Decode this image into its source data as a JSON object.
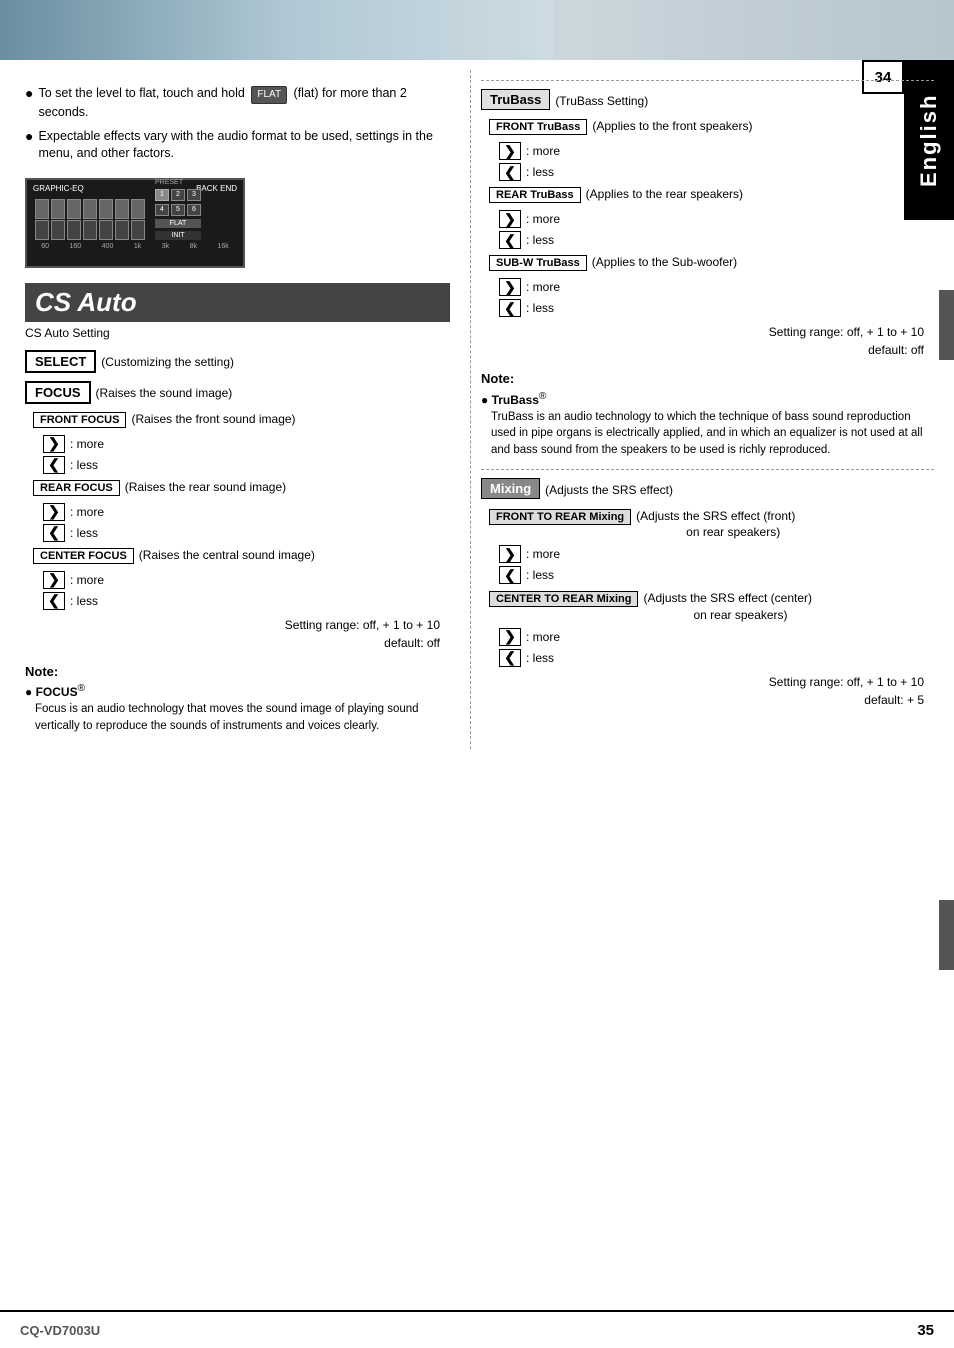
{
  "page": {
    "number_left": "34",
    "number_right": "35",
    "model": "CQ-VD7003U",
    "language": "English"
  },
  "left": {
    "bullets": [
      {
        "id": "b1",
        "text_before": "To set the level to flat, touch and hold",
        "btn_label": "FLAT",
        "text_after": "(flat) for more than 2 seconds."
      },
      {
        "id": "b2",
        "text": "Expectable effects vary with the audio format to be used, settings in the menu, and other factors."
      }
    ],
    "section_title": "CS Auto",
    "section_subtitle": "CS Auto Setting",
    "select_label": "SELECT",
    "select_desc": "(Customizing the setting)",
    "focus_label": "FOCUS",
    "focus_desc": "(Raises the sound image)",
    "front_focus_label": "FRONT FOCUS",
    "front_focus_desc": "(Raises the front sound image)",
    "rear_focus_label": "REAR FOCUS",
    "rear_focus_desc": "(Raises the rear sound image)",
    "center_focus_label": "CENTER FOCUS",
    "center_focus_desc": "(Raises the central sound image)",
    "more_label": ": more",
    "less_label": ": less",
    "setting_range_line1": "Setting range: off, + 1 to + 10",
    "setting_range_line2": "default: off",
    "note_title": "Note:",
    "note_bullet": "● FOCUS",
    "note_superscript": "®",
    "note_body": "Focus is an audio technology that moves the sound image of playing sound vertically to reproduce the sounds of instruments and voices clearly."
  },
  "right": {
    "trubass_section": {
      "header": "TruBass",
      "header_paren": "(TruBass Setting)",
      "front_label": "FRONT TruBass",
      "front_desc": "(Applies to the front speakers)",
      "rear_label": "REAR TruBass",
      "rear_desc": "(Applies to the rear speakers)",
      "subw_label": "SUB-W TruBass",
      "subw_desc": "(Applies to the Sub-woofer)",
      "more_label": ": more",
      "less_label": ": less",
      "setting_range_line1": "Setting range: off, + 1 to + 10",
      "setting_range_line2": "default: off",
      "note_title": "Note:",
      "note_bullet": "● TruBass",
      "note_superscript": "®",
      "note_body": "TruBass is an audio technology to which the technique of bass sound reproduction used in pipe organs is electrically applied, and in which an equalizer is not used at all and bass sound from the speakers to be used is richly reproduced."
    },
    "mixing_section": {
      "header": "Mixing",
      "header_paren": "(Adjusts the SRS effect)",
      "front_to_rear_label": "FRONT TO REAR Mixing",
      "front_to_rear_desc_line1": "(Adjusts the SRS effect (front)",
      "front_to_rear_desc_line2": "on rear speakers)",
      "center_to_rear_label": "CENTER TO REAR Mixing",
      "center_to_rear_desc_line1": "(Adjusts the SRS effect (center)",
      "center_to_rear_desc_line2": "on rear speakers)",
      "more_label": ": more",
      "less_label": ": less",
      "setting_range_line1": "Setting range: off, + 1 to + 10",
      "setting_range_line2": "default: + 5"
    }
  },
  "icons": {
    "arrow_right": "❯",
    "arrow_left": "❮",
    "bullet": "●"
  }
}
